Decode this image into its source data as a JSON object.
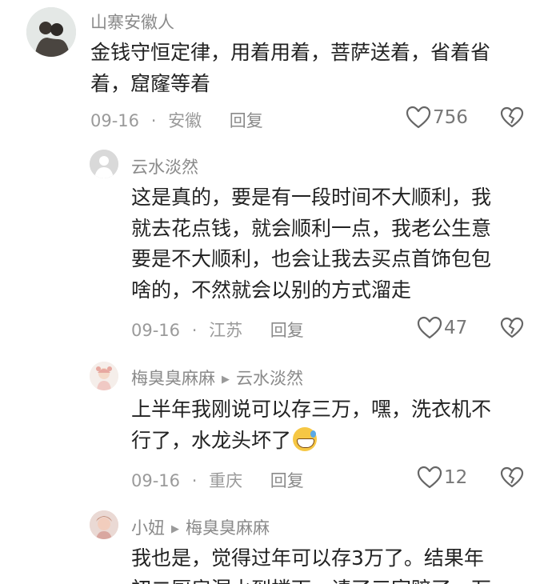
{
  "comments": [
    {
      "username": "山寨安徽人",
      "reply_to": "",
      "lines": [
        "金钱守恒定律，用着用着，菩萨送着，省着省",
        "着，窟窿等着"
      ],
      "date": "09-16",
      "location": "安徽",
      "reply_label": "回复",
      "likes": "756"
    },
    {
      "username": "云水淡然",
      "reply_to": "",
      "lines": [
        "这是真的，要是有一段时间不大顺利，我",
        "就去花点钱，就会顺利一点，我老公生意",
        "要是不大顺利，也会让我去买点首饰包包",
        "啥的，不然就会以别的方式溜走"
      ],
      "date": "09-16",
      "location": "江苏",
      "reply_label": "回复",
      "likes": "47"
    },
    {
      "username": "梅臭臭麻麻",
      "reply_to": "云水淡然",
      "lines": [
        "上半年我刚说可以存三万，嘿，洗衣机不",
        "行了，水龙头坏了"
      ],
      "date": "09-16",
      "location": "重庆",
      "reply_label": "回复",
      "likes": "12"
    },
    {
      "username": "小妞",
      "reply_to": "梅臭臭麻麻",
      "lines": [
        "我也是，觉得过年可以存3万了。结果年",
        "初二厨房漏水到楼下，请了三家赔了一万"
      ],
      "date": "",
      "location": "",
      "reply_label": "",
      "likes": ""
    }
  ],
  "separator": "·",
  "icons": {
    "like": "heart-outline-icon",
    "dislike": "broken-heart-icon",
    "reply_arrow": "triangle-right-icon",
    "emoji": "grinning-sweat-emoji"
  },
  "colors": {
    "username": "#8a8a8a",
    "content": "#222222",
    "meta": "#9a9a9a"
  }
}
